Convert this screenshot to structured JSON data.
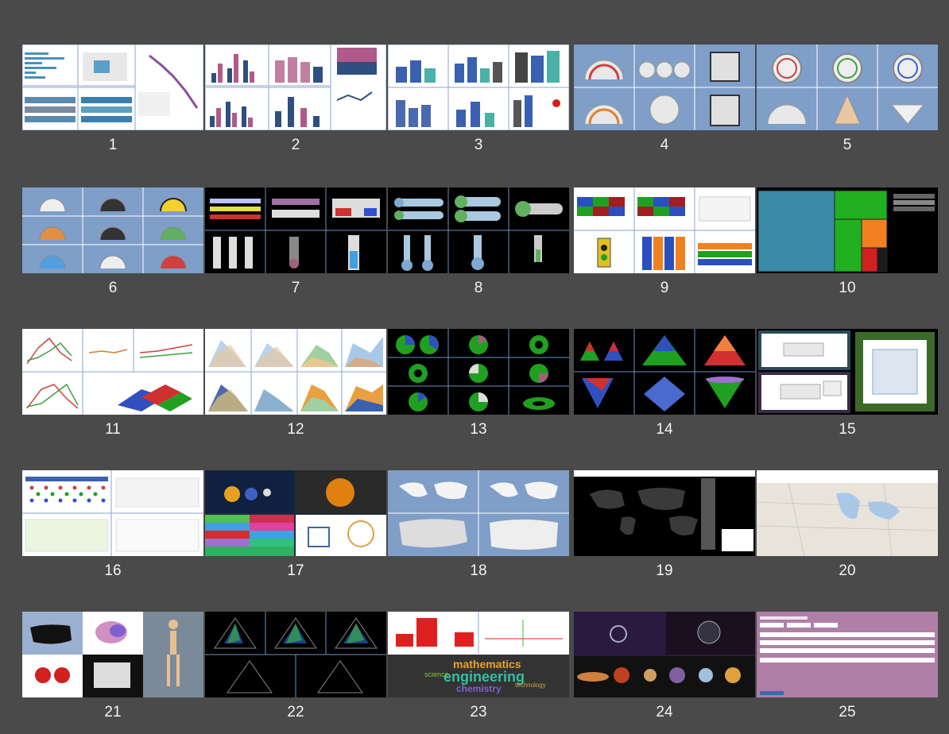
{
  "gallery": {
    "thumbnails": [
      {
        "number": "1",
        "theme": "light",
        "kind": "bar-gantt"
      },
      {
        "number": "2",
        "theme": "light",
        "kind": "column-line"
      },
      {
        "number": "3",
        "theme": "light",
        "kind": "3d-columns"
      },
      {
        "number": "4",
        "theme": "blue",
        "kind": "gauges"
      },
      {
        "number": "5",
        "theme": "blue",
        "kind": "gauges"
      },
      {
        "number": "6",
        "theme": "blue",
        "kind": "half-gauges"
      },
      {
        "number": "7",
        "theme": "dark",
        "kind": "linear-gauges"
      },
      {
        "number": "8",
        "theme": "dark",
        "kind": "thermometers"
      },
      {
        "number": "9",
        "theme": "light",
        "kind": "heatmap-traffic"
      },
      {
        "number": "10",
        "theme": "dark",
        "kind": "treemap"
      },
      {
        "number": "11",
        "theme": "light",
        "kind": "lines"
      },
      {
        "number": "12",
        "theme": "light",
        "kind": "areas"
      },
      {
        "number": "13",
        "theme": "dark",
        "kind": "pies"
      },
      {
        "number": "14",
        "theme": "dark",
        "kind": "pyramids"
      },
      {
        "number": "15",
        "theme": "dark",
        "kind": "tables"
      },
      {
        "number": "16",
        "theme": "light",
        "kind": "matrix"
      },
      {
        "number": "17",
        "theme": "mixed",
        "kind": "images"
      },
      {
        "number": "18",
        "theme": "blue",
        "kind": "maps"
      },
      {
        "number": "19",
        "theme": "dark",
        "kind": "world-map"
      },
      {
        "number": "20",
        "theme": "light",
        "kind": "road-map"
      },
      {
        "number": "21",
        "theme": "mixed",
        "kind": "illustrations"
      },
      {
        "number": "22",
        "theme": "dark",
        "kind": "radar"
      },
      {
        "number": "23",
        "theme": "mixed",
        "kind": "wordcloud"
      },
      {
        "number": "24",
        "theme": "dark",
        "kind": "space-images"
      },
      {
        "number": "25",
        "theme": "purple",
        "kind": "form"
      }
    ],
    "wordcloud_words": [
      "mathematics",
      "engineering",
      "science",
      "chemistry",
      "technology"
    ],
    "colors": {
      "background": "#4a4a4a",
      "blue_panel": "#7f9ec8",
      "purple_panel": "#b07fa8",
      "label": "#f2f2f2"
    }
  }
}
